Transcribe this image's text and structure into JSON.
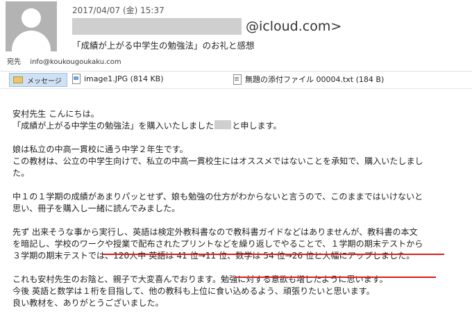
{
  "header": {
    "date": "2017/04/07 (金) 15:37",
    "from_domain": "@icloud.com>",
    "subject": "「成績が上がる中学生の勉強法」のお礼と感想",
    "to_label": "宛先",
    "to_address": "info@koukougoukaku.com"
  },
  "attachments": {
    "message_tab": "メッセージ",
    "files": [
      {
        "name": "image1.JPG (814 KB)",
        "icon": "image-file-icon"
      },
      {
        "name": "無題の添付ファイル 00004.txt (184 B)",
        "icon": "text-file-icon"
      }
    ]
  },
  "body": {
    "greeting": "安村先生 こんにちは。",
    "intro_a": "「成績が上がる中学生の勉強法」を購入いたしました",
    "intro_b": "と申します。",
    "p2_l1": "娘は私立の中高一貫校に通う中学２年生です。",
    "p2_l2": "この教材は、公立の中学生向けで、私立の中高一貫校生にはオススメではないことを承知で、購入いたしまし",
    "p2_l3": "た。",
    "p3_l1": "中１の１学期の成績があまりパッとせず、娘も勉強の仕方がわからないと言うので、このままではいけないと",
    "p3_l2": "思い、冊子を購入し一緒に読んでみました。",
    "p4_l1": "先ず 出来そうな事から実行し、英語は検定外教科書なので教科書ガイドなどはありませんが、教科書の本文",
    "p4_l2": "を暗記し、学校のワークや授業で配布されたプリントなどを繰り返しでやることで、１学期の期末テストから",
    "p4_l3": "３学期の期末テストでは、120人中 英語は 41 位→11 位、数学は 54 位→26 位と大幅にアップしました。",
    "p5_l1": "これも安村先生のお陰と、親子で大変喜んでおります。勉強に対する意欲も増したように思います。",
    "p5_l2": "今後 英語と数学は１桁を目指して、他の教科も上位に食い込めるよう、頑張りたいと思います。",
    "p5_l3": "良い教材を、ありがとうございました。"
  },
  "colors": {
    "underline": "#d81b1b",
    "message_tab_bg": "#cfe1f5",
    "avatar_bg": "#b3b3b3"
  }
}
